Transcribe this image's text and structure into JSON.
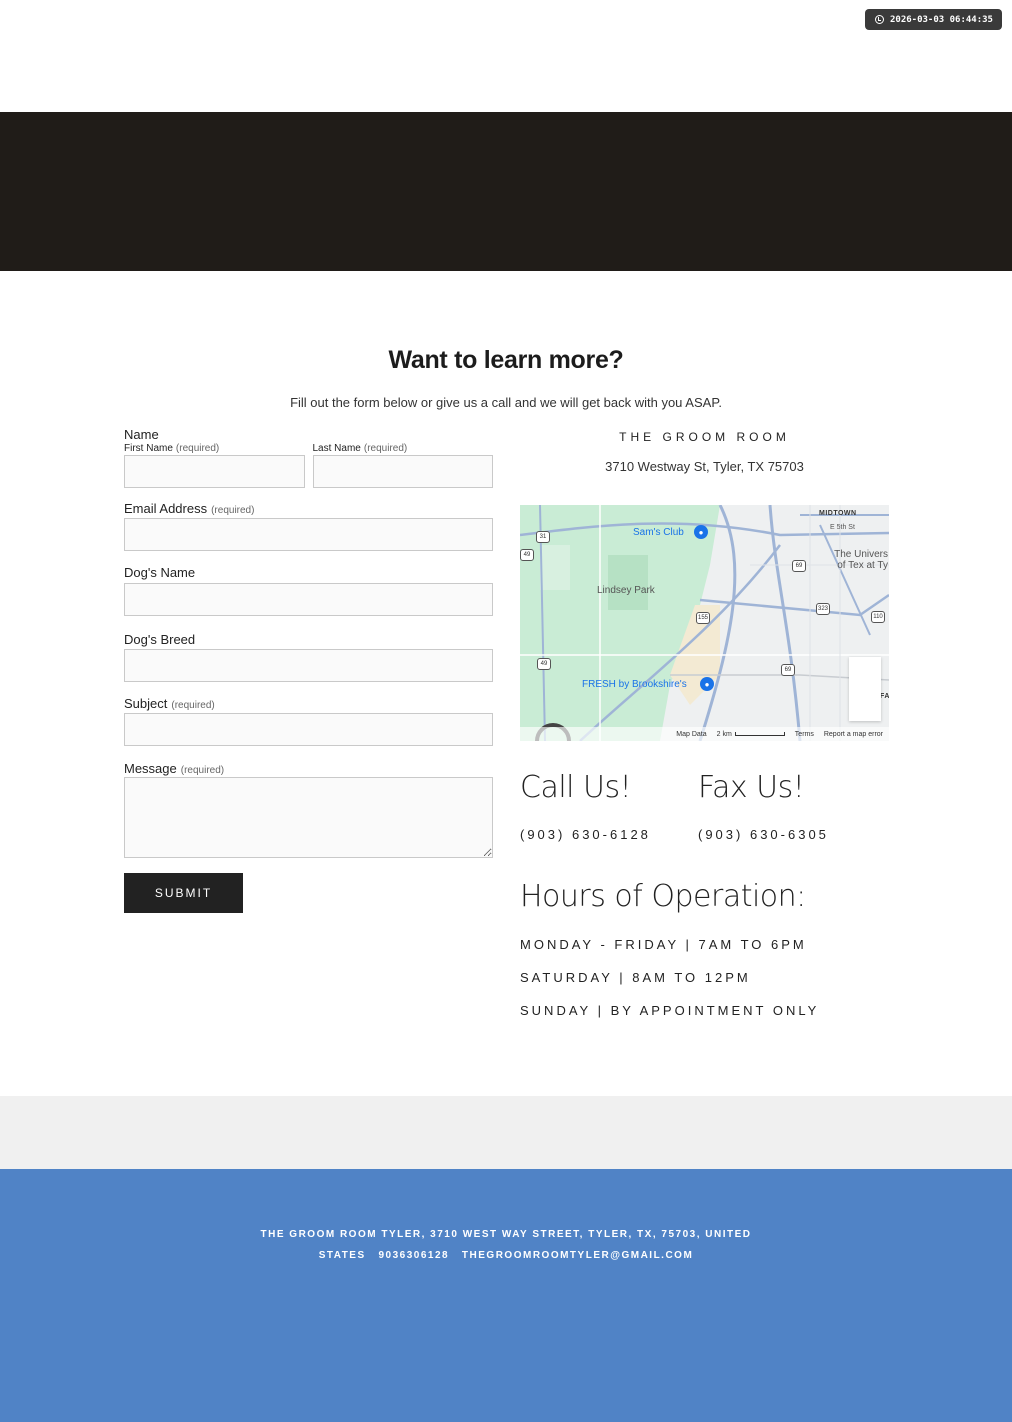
{
  "timestamp": "2026-03-03 06:44:35",
  "heading": "Want to learn more?",
  "subheading": "Fill out the form below or give us a call and we will get back with you ASAP.",
  "form": {
    "name_label": "Name",
    "first_name_label": "First Name",
    "last_name_label": "Last Name",
    "required": "(required)",
    "email_label": "Email Address",
    "dog_name_label": "Dog's Name",
    "dog_breed_label": "Dog's Breed",
    "subject_label": "Subject",
    "message_label": "Message",
    "submit_label": "SUBMIT"
  },
  "business": {
    "name": "THE GROOM ROOM",
    "address": "3710 Westway St, Tyler, TX 75703"
  },
  "map": {
    "labels": {
      "sams_club": "Sam's Club",
      "lindsey_park": "Lindsey Park",
      "fresh": "FRESH by Brookshire's",
      "midtown": "MIDTOWN",
      "e5th": "E 5th St",
      "university": "The Univers of Tex at Ty",
      "fa": "FA"
    },
    "shields": [
      "31",
      "49",
      "69",
      "155",
      "323",
      "110",
      "49",
      "69"
    ],
    "footer": {
      "map_data": "Map Data",
      "scale": "2 km",
      "terms": "Terms",
      "report": "Report a map error"
    }
  },
  "contact": {
    "call_heading": "Call Us!",
    "call_number": "(903) 630-6128",
    "fax_heading": "Fax Us!",
    "fax_number": "(903) 630-6305"
  },
  "hours": {
    "heading": "Hours of Operation:",
    "lines": [
      "MONDAY - FRIDAY | 7AM TO 6PM",
      "SATURDAY | 8AM TO 12PM",
      "SUNDAY | BY APPOINTMENT ONLY"
    ]
  },
  "footer": {
    "line1": "THE GROOM ROOM TYLER, 3710 WEST WAY STREET, TYLER, TX, 75703, UNITED",
    "line2": "STATES   9036306128   THEGROOMROOMTYLER@GMAIL.COM"
  },
  "colors": {
    "dark_banner": "#201c18",
    "footer": "#5083c6",
    "grey_band": "#f0f0f0",
    "map_link": "#1a73e8"
  }
}
